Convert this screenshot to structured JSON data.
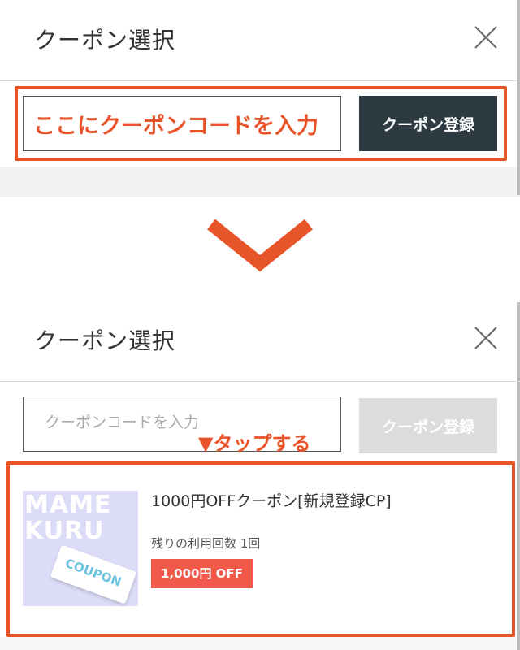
{
  "top": {
    "header_title": "クーポン選択",
    "code_input_value": "ここにクーポンコードを入力",
    "register_label": "クーポン登録"
  },
  "bottom": {
    "header_title": "クーポン選択",
    "code_input_placeholder": "クーポンコードを入力",
    "register_label": "クーポン登録",
    "tap_hint": "▼タップする",
    "coupon": {
      "title": "1000円OFFクーポン[新規登録CP]",
      "remaining": "残りの利用回数 1回",
      "badge": "1,000円 OFF",
      "thumb_brand_line1": "MAME",
      "thumb_brand_line2": "KURU",
      "thumb_ticket_text": "COUPON"
    }
  },
  "colors": {
    "accent": "#e8542a",
    "button_active": "#2d3a42",
    "button_disabled": "#dcdcdc",
    "badge": "#f15a4a"
  },
  "icons": {
    "close": "close-icon",
    "arrow": "chevron-down-icon"
  }
}
